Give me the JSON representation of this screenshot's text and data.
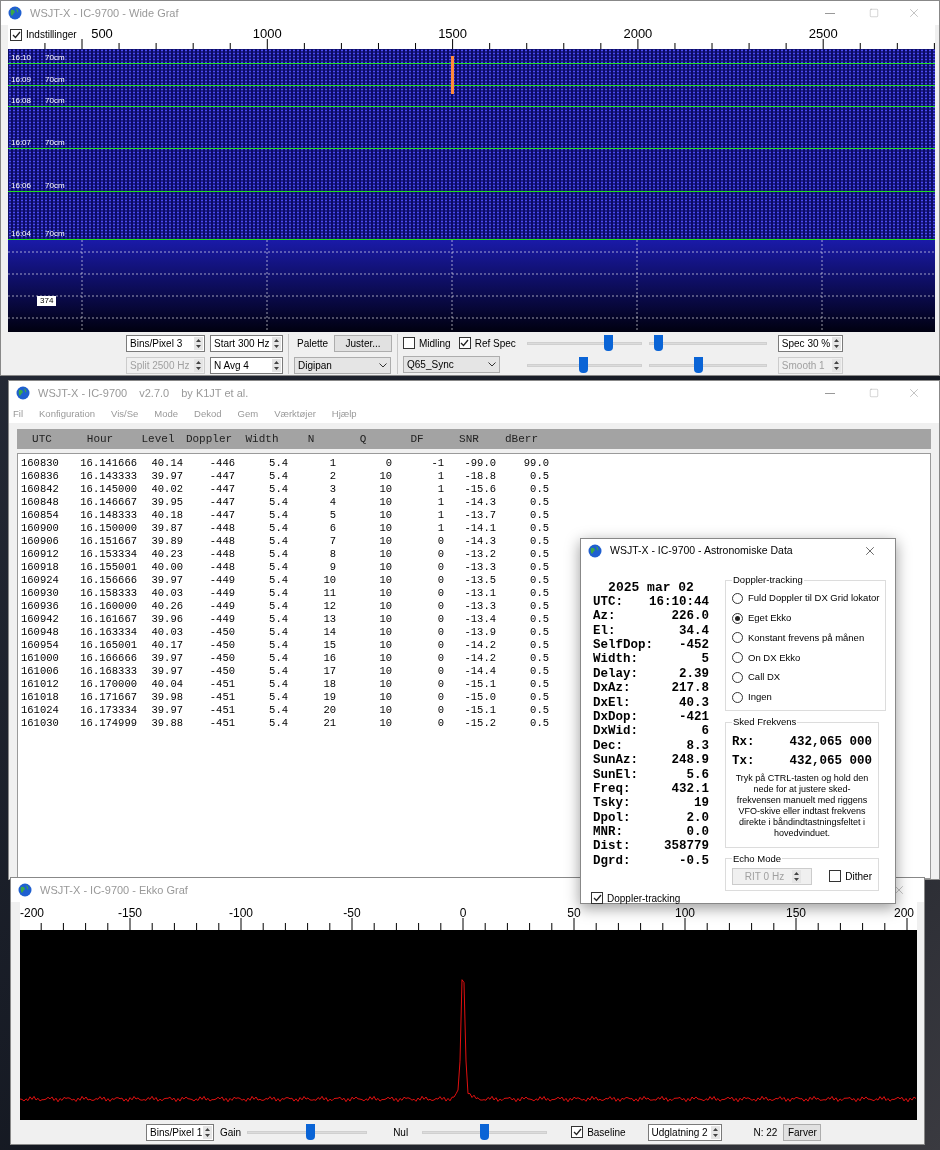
{
  "wide_graf": {
    "title": "WSJT-X - IC-9700 - Wide Graf",
    "active": false,
    "settings_checkbox": {
      "label": "Indstillinger",
      "checked": true
    },
    "freq_labels": [
      "500",
      "1000",
      "1500",
      "2000",
      "2500"
    ],
    "waterfall_marks": [
      {
        "time": "16:10",
        "band": "70cm"
      },
      {
        "time": "16:09",
        "band": "70cm"
      },
      {
        "time": "16:08",
        "band": "70cm"
      },
      {
        "time": "16:07",
        "band": "70cm"
      },
      {
        "time": "16:06",
        "band": "70cm"
      },
      {
        "time": "16:04",
        "band": "70cm"
      }
    ],
    "spectrum_label": "374",
    "spinboxes": [
      {
        "value": "Bins/Pixel 3",
        "disabled": false
      },
      {
        "value": "Start 300 Hz",
        "disabled": false
      },
      {
        "value": "Split 2500 Hz",
        "disabled": true
      },
      {
        "value": "N Avg 4",
        "disabled": false
      }
    ],
    "palette_label": "Palette",
    "adjust_button": "Juster...",
    "palette_select": "Digipan",
    "checkboxes": [
      {
        "label": "Midling",
        "checked": false
      },
      {
        "label": "Ref Spec",
        "checked": true
      }
    ],
    "mode_select": "Q65_Sync",
    "sliders": [
      {
        "level": 0.71
      },
      {
        "level": 0.08
      },
      {
        "level": 0.49
      },
      {
        "level": 0.42
      }
    ],
    "spec_spinbox": {
      "value": "Spec 30 %",
      "disabled": false
    },
    "smooth_spinbox": {
      "value": "Smooth 1",
      "disabled": true
    }
  },
  "main_window": {
    "title_parts": [
      "WSJT-X - IC-9700",
      "v2.7.0",
      "by K1JT et al."
    ],
    "active": false,
    "menu": [
      "Fil",
      "Konfiguration",
      "Vis/Se",
      "Mode",
      "Dekod",
      "Gem",
      "Værktøjer",
      "Hjælp"
    ],
    "table": {
      "columns": [
        "UTC",
        "Hour",
        "Level",
        "Doppler",
        "Width",
        "N",
        "Q",
        "DF",
        "SNR",
        "dBerr"
      ],
      "rows": [
        [
          "160830",
          "16.141666",
          "40.14",
          "-446",
          "5.4",
          "1",
          "0",
          "-1",
          "-99.0",
          "99.0"
        ],
        [
          "160836",
          "16.143333",
          "39.97",
          "-447",
          "5.4",
          "2",
          "10",
          "1",
          "-18.8",
          "0.5"
        ],
        [
          "160842",
          "16.145000",
          "40.02",
          "-447",
          "5.4",
          "3",
          "10",
          "1",
          "-15.6",
          "0.5"
        ],
        [
          "160848",
          "16.146667",
          "39.95",
          "-447",
          "5.4",
          "4",
          "10",
          "1",
          "-14.3",
          "0.5"
        ],
        [
          "160854",
          "16.148333",
          "40.18",
          "-447",
          "5.4",
          "5",
          "10",
          "1",
          "-13.7",
          "0.5"
        ],
        [
          "160900",
          "16.150000",
          "39.87",
          "-448",
          "5.4",
          "6",
          "10",
          "1",
          "-14.1",
          "0.5"
        ],
        [
          "160906",
          "16.151667",
          "39.89",
          "-448",
          "5.4",
          "7",
          "10",
          "0",
          "-14.3",
          "0.5"
        ],
        [
          "160912",
          "16.153334",
          "40.23",
          "-448",
          "5.4",
          "8",
          "10",
          "0",
          "-13.2",
          "0.5"
        ],
        [
          "160918",
          "16.155001",
          "40.00",
          "-448",
          "5.4",
          "9",
          "10",
          "0",
          "-13.3",
          "0.5"
        ],
        [
          "160924",
          "16.156666",
          "39.97",
          "-449",
          "5.4",
          "10",
          "10",
          "0",
          "-13.5",
          "0.5"
        ],
        [
          "160930",
          "16.158333",
          "40.03",
          "-449",
          "5.4",
          "11",
          "10",
          "0",
          "-13.1",
          "0.5"
        ],
        [
          "160936",
          "16.160000",
          "40.26",
          "-449",
          "5.4",
          "12",
          "10",
          "0",
          "-13.3",
          "0.5"
        ],
        [
          "160942",
          "16.161667",
          "39.96",
          "-449",
          "5.4",
          "13",
          "10",
          "0",
          "-13.4",
          "0.5"
        ],
        [
          "160948",
          "16.163334",
          "40.03",
          "-450",
          "5.4",
          "14",
          "10",
          "0",
          "-13.9",
          "0.5"
        ],
        [
          "160954",
          "16.165001",
          "40.17",
          "-450",
          "5.4",
          "15",
          "10",
          "0",
          "-14.2",
          "0.5"
        ],
        [
          "161000",
          "16.166666",
          "39.97",
          "-450",
          "5.4",
          "16",
          "10",
          "0",
          "-14.2",
          "0.5"
        ],
        [
          "161006",
          "16.168333",
          "39.97",
          "-450",
          "5.4",
          "17",
          "10",
          "0",
          "-14.4",
          "0.5"
        ],
        [
          "161012",
          "16.170000",
          "40.04",
          "-451",
          "5.4",
          "18",
          "10",
          "0",
          "-15.1",
          "0.5"
        ],
        [
          "161018",
          "16.171667",
          "39.98",
          "-451",
          "5.4",
          "19",
          "10",
          "0",
          "-15.0",
          "0.5"
        ],
        [
          "161024",
          "16.173334",
          "39.97",
          "-451",
          "5.4",
          "20",
          "10",
          "0",
          "-15.1",
          "0.5"
        ],
        [
          "161030",
          "16.174999",
          "39.88",
          "-451",
          "5.4",
          "21",
          "10",
          "0",
          "-15.2",
          "0.5"
        ]
      ]
    }
  },
  "ekko_graf": {
    "title": "WSJT-X - IC-9700 - Ekko Graf",
    "active": false,
    "scale_labels": [
      "-200",
      "-150",
      "-100",
      "-50",
      "0",
      "50",
      "100",
      "150",
      "200"
    ],
    "bins_spinbox": {
      "value": "Bins/Pixel 1",
      "disabled": false
    },
    "gain_label": "Gain",
    "gain_slider": {
      "level": 0.53
    },
    "nul_label": "Nul",
    "nul_slider": {
      "level": 0.5
    },
    "baseline": {
      "label": "Baseline",
      "checked": true
    },
    "smoothing_spinbox": {
      "value": "Udglatning 2",
      "disabled": false
    },
    "count": "N: 22",
    "colors_button": "Farver"
  },
  "astro": {
    "title": "WSJT-X - IC-9700 - Astronomiske Data",
    "active": true,
    "date": "2025 mar 02",
    "readings": [
      {
        "label": "UTC:",
        "value": "16:10:44"
      },
      {
        "label": "Az:",
        "value": "226.0"
      },
      {
        "label": "El:",
        "value": "34.4"
      },
      {
        "label": "SelfDop:",
        "value": "-452"
      },
      {
        "label": "Width:",
        "value": "5"
      },
      {
        "label": "Delay:",
        "value": "2.39"
      },
      {
        "label": "DxAz:",
        "value": "217.8"
      },
      {
        "label": "DxEl:",
        "value": "40.3"
      },
      {
        "label": "DxDop:",
        "value": "-421"
      },
      {
        "label": "DxWid:",
        "value": "6"
      },
      {
        "label": "Dec:",
        "value": "8.3"
      },
      {
        "label": "SunAz:",
        "value": "248.9"
      },
      {
        "label": "SunEl:",
        "value": "5.6"
      },
      {
        "label": "Freq:",
        "value": "432.1"
      },
      {
        "label": "Tsky:",
        "value": "19"
      },
      {
        "label": "Dpol:",
        "value": "2.0"
      },
      {
        "label": "MNR:",
        "value": "0.0"
      },
      {
        "label": "Dist:",
        "value": "358779"
      },
      {
        "label": "Dgrd:",
        "value": "-0.5"
      }
    ],
    "doppler_group": {
      "title": "Doppler-tracking",
      "options": [
        {
          "label": "Fuld Doppler til DX Grid lokator",
          "selected": false
        },
        {
          "label": "Eget Ekko",
          "selected": true
        },
        {
          "label": "Konstant frevens på månen",
          "selected": false
        },
        {
          "label": "On DX Ekko",
          "selected": false
        },
        {
          "label": "Call DX",
          "selected": false
        },
        {
          "label": "Ingen",
          "selected": false
        }
      ]
    },
    "sked_group": {
      "title": "Sked Frekvens",
      "rx_label": "Rx:",
      "rx_value": "432,065 000",
      "tx_label": "Tx:",
      "tx_value": "432,065 000",
      "help": "Tryk på CTRL-tasten og hold den nede for at justere sked-frekvensen manuelt med riggens VFO-skive eller indtast frekvens direkte i båndindtastningsfeltet i hovedvinduet."
    },
    "echo_group": {
      "title": "Echo Mode",
      "rit_spinbox": {
        "value": "RIT 0 Hz",
        "disabled": true
      },
      "dither": {
        "label": "Dither",
        "checked": false
      }
    },
    "tracking_checkbox": {
      "label": "Doppler-tracking",
      "checked": true
    }
  }
}
